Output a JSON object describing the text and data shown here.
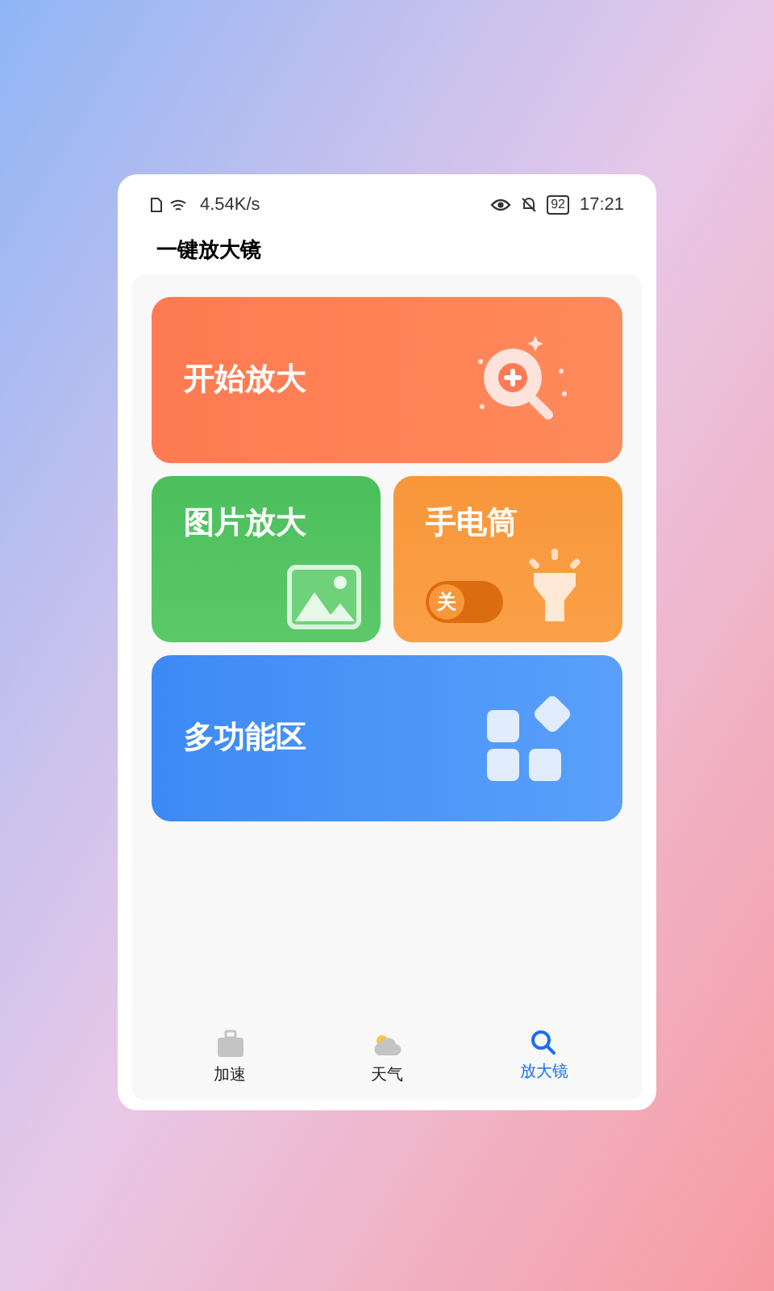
{
  "status_bar": {
    "speed": "4.54K/s",
    "battery": "92",
    "time": "17:21"
  },
  "app_title": "一键放大镜",
  "tiles": [
    {
      "kind": "magnify",
      "label": "开始放大"
    },
    {
      "kind": "photo",
      "label": "图片放大"
    },
    {
      "kind": "flashlight",
      "label": "手电筒",
      "toggle": {
        "label": "关",
        "on": false
      }
    },
    {
      "kind": "tools",
      "label": "多功能区"
    }
  ],
  "nav": [
    {
      "kind": "boost",
      "label": "加速",
      "selected": false
    },
    {
      "kind": "weather",
      "label": "天气",
      "selected": false
    },
    {
      "kind": "magnifier",
      "label": "放大镜",
      "selected": true
    }
  ]
}
